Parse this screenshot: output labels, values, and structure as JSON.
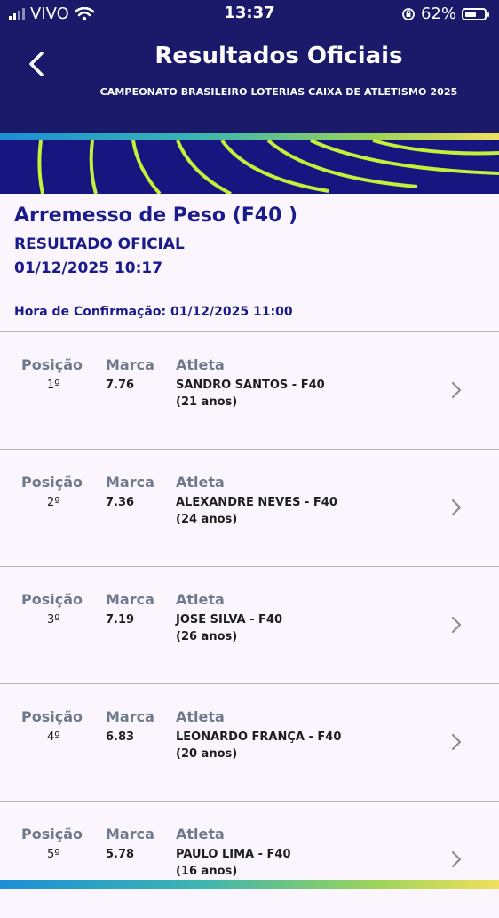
{
  "status_bar": {
    "carrier": "VIVO",
    "time": "13:37",
    "battery": "62%",
    "battery_level": 0.62
  },
  "header": {
    "title": "Resultados Oficiais",
    "subtitle": "CAMPEONATO BRASILEIRO LOTERIAS CAIXA DE ATLETISMO 2025"
  },
  "event": {
    "name": "Arremesso de Peso (F40 )",
    "status": "RESULTADO OFICIAL",
    "datetime": "01/12/2025 10:17",
    "confirmation": "Hora de Confirmação: 01/12/2025 11:00"
  },
  "columns": {
    "position": "Posição",
    "mark": "Marca",
    "athlete": "Atleta"
  },
  "results": [
    {
      "position": "1º",
      "mark": "7.76",
      "athlete": "SANDRO SANTOS - F40",
      "age": "(21 anos)"
    },
    {
      "position": "2º",
      "mark": "7.36",
      "athlete": "ALEXANDRE NEVES - F40",
      "age": "(24 anos)"
    },
    {
      "position": "3º",
      "mark": "7.19",
      "athlete": "JOSE SILVA - F40",
      "age": "(26 anos)"
    },
    {
      "position": "4º",
      "mark": "6.83",
      "athlete": "LEONARDO FRANÇA - F40",
      "age": "(20 anos)"
    },
    {
      "position": "5º",
      "mark": "5.78",
      "athlete": "PAULO LIMA - F40",
      "age": "(16 anos)"
    }
  ],
  "colors": {
    "header_bg": "#1b1a6a",
    "banner_bg": "#171580",
    "accent_green": "#c6ef3a",
    "title_blue": "#1c1b8c",
    "column_header": "#6e7a8c",
    "page_bg": "#fbf6fd"
  }
}
